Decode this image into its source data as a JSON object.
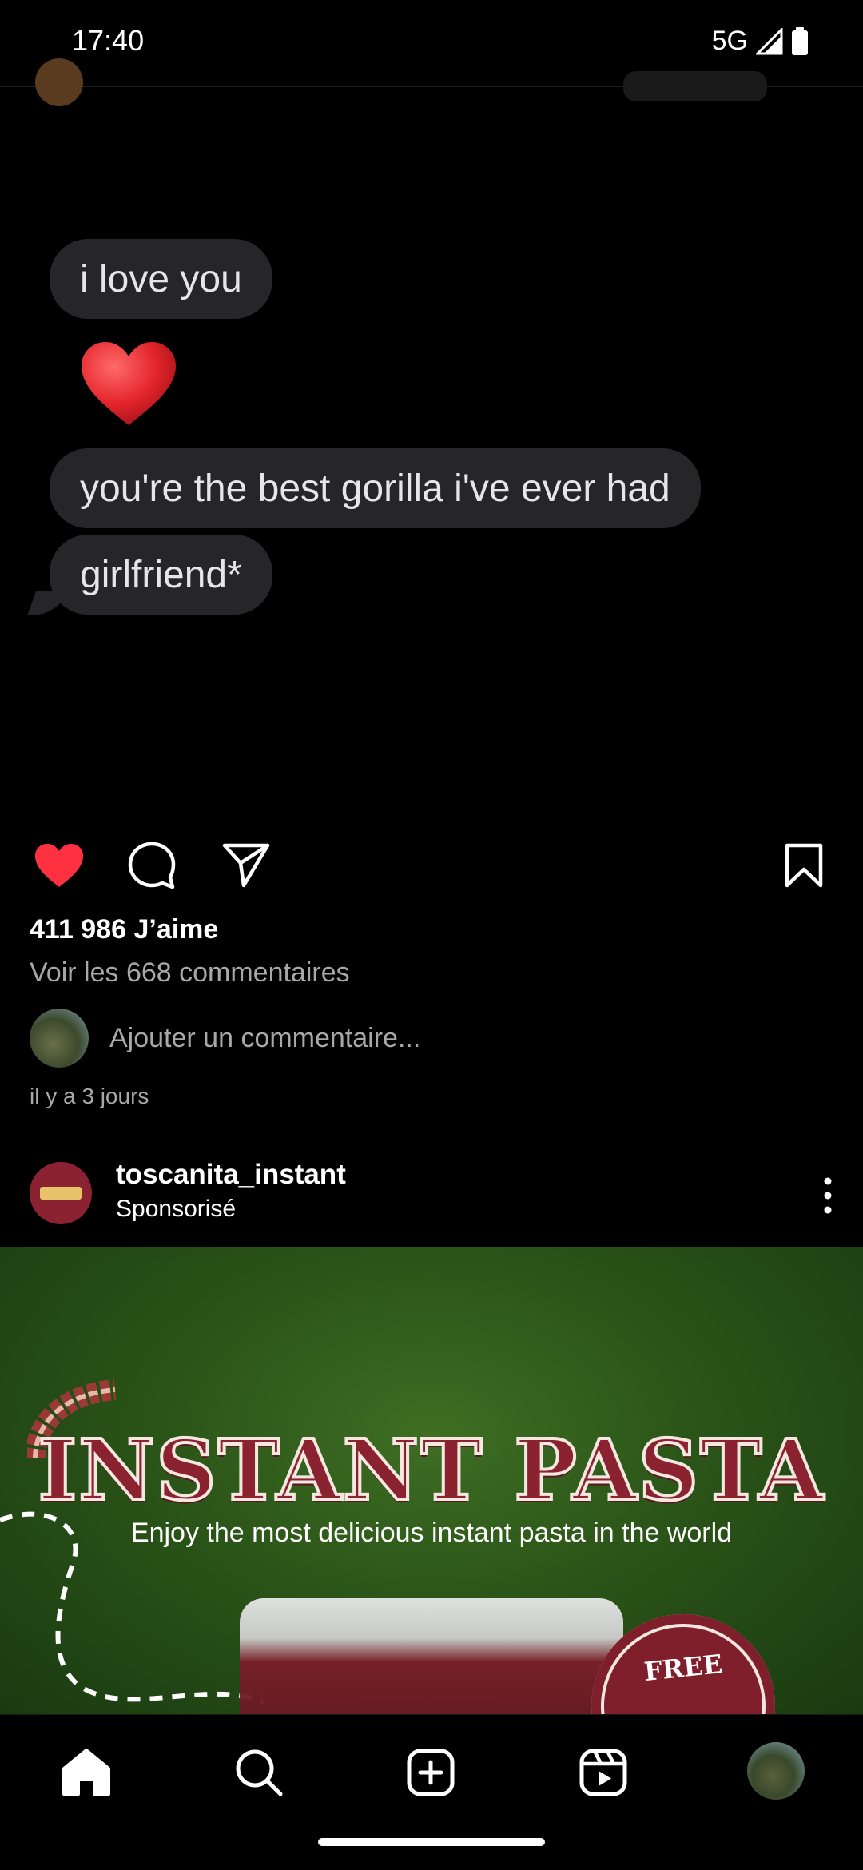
{
  "status_bar": {
    "time": "17:40",
    "network": "5G"
  },
  "post": {
    "messages": [
      "i love you",
      "you're the best gorilla i've ever had",
      "girlfriend*"
    ],
    "likes": "411 986 J’aime",
    "view_comments": "Voir les 668 commentaires",
    "comment_placeholder": "Ajouter un commentaire...",
    "time_ago": "il y a 3 jours",
    "liked": true
  },
  "sponsored": {
    "username": "toscanita_instant",
    "label": "Sponsorisé",
    "ad": {
      "title": "INSTANT PASTA",
      "subtitle": "Enjoy the most delicious instant pasta in the world",
      "badge": "FREE"
    }
  },
  "nav": {
    "items": [
      "home-icon",
      "search-icon",
      "create-icon",
      "reels-icon",
      "profile-avatar"
    ]
  },
  "colors": {
    "background": "#000000",
    "like_red": "#ff3040",
    "secondary_text": "#a8a8a8",
    "ad_green": "#2a5418",
    "pasta_red": "#8a2230"
  }
}
